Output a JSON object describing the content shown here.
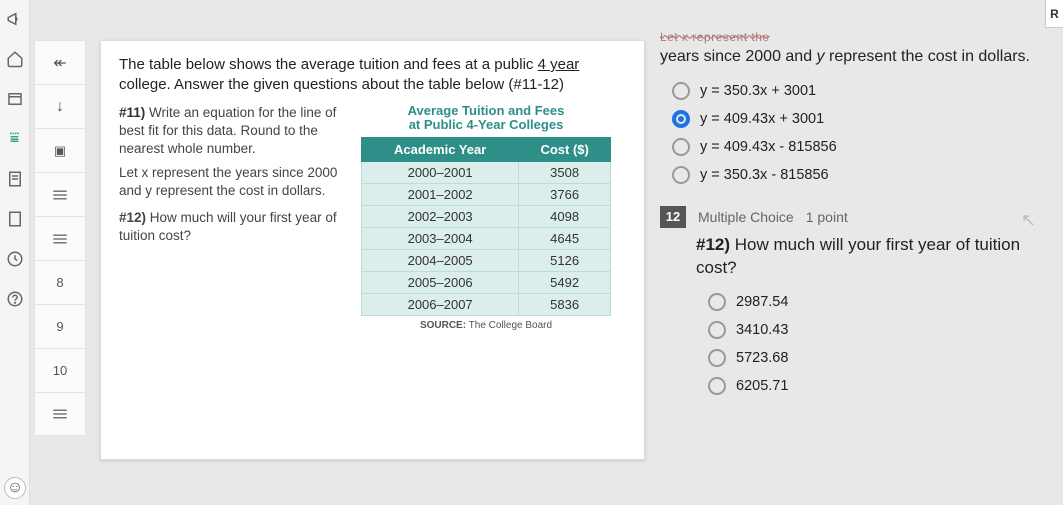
{
  "leftRail": {
    "icons": [
      "megaphone",
      "home",
      "window",
      "stack",
      "sheet",
      "clock",
      "help"
    ]
  },
  "nav": {
    "items": [
      {
        "kind": "icon",
        "name": "back-arrow",
        "glyph": "↞"
      },
      {
        "kind": "icon",
        "name": "down-arrow",
        "glyph": "↓"
      },
      {
        "kind": "icon",
        "name": "camera",
        "glyph": "▣"
      },
      {
        "kind": "icon",
        "name": "lines",
        "glyph": "≣"
      },
      {
        "kind": "icon",
        "name": "lines-2",
        "glyph": "≣"
      },
      {
        "kind": "num",
        "label": "8"
      },
      {
        "kind": "num",
        "label": "9"
      },
      {
        "kind": "num",
        "label": "10"
      },
      {
        "kind": "icon",
        "name": "lines-3",
        "glyph": "≣"
      }
    ]
  },
  "passage": {
    "intro_pre": "The table below shows the average tuition and fees at a public ",
    "intro_underlined": "4 year",
    "intro_post": " college.  Answer the given questions about the table below (#11-12)",
    "q11_lead": "#11)",
    "q11_body": " Write an equation for the line of best fit for this data. Round to the nearest whole number.",
    "q11_let": "Let x represent the years since 2000 and y represent the cost in dollars.",
    "q12_lead": "#12)",
    "q12_body": " How much will your first year of tuition cost?",
    "table_title_l1": "Average Tuition and Fees",
    "table_title_l2": "at Public 4-Year Colleges",
    "col_year": "Academic Year",
    "col_cost": "Cost ($)",
    "rows": [
      {
        "year": "2000–2001",
        "cost": "3508"
      },
      {
        "year": "2001–2002",
        "cost": "3766"
      },
      {
        "year": "2002–2003",
        "cost": "4098"
      },
      {
        "year": "2003–2004",
        "cost": "4645"
      },
      {
        "year": "2004–2005",
        "cost": "5126"
      },
      {
        "year": "2005–2006",
        "cost": "5492"
      },
      {
        "year": "2006–2007",
        "cost": "5836"
      }
    ],
    "source_label": "SOURCE:",
    "source_val": " The College Board"
  },
  "q11": {
    "truncated": "Let x represent the",
    "stem_a": "years since 2000 and ",
    "stem_b": "y",
    "stem_c": " represent the cost in dollars.",
    "options": [
      {
        "text": "y = 350.3x + 3001",
        "selected": false
      },
      {
        "text": "y = 409.43x + 3001",
        "selected": true
      },
      {
        "text": "y = 409.43x - 815856",
        "selected": false
      },
      {
        "text": "y = 350.3x - 815856",
        "selected": false
      }
    ]
  },
  "q12": {
    "number": "12",
    "type": "Multiple Choice",
    "points": "1 point",
    "title_lead": "#12)",
    "title_rest": " How much will your first year of tuition cost?",
    "options": [
      {
        "text": "2987.54"
      },
      {
        "text": "3410.43"
      },
      {
        "text": "5723.68"
      },
      {
        "text": "6205.71"
      }
    ]
  },
  "corner": "R"
}
